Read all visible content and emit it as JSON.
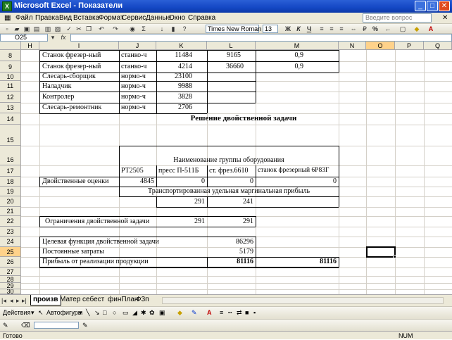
{
  "window": {
    "title": "Microsoft Excel - Показатели",
    "icon_text": "X"
  },
  "menu": {
    "items": [
      "Файл",
      "Правка",
      "Вид",
      "Вставка",
      "Формат",
      "Сервис",
      "Данные",
      "Окно",
      "Справка"
    ],
    "help_placeholder": "Введите вопрос"
  },
  "toolbar": {
    "font_name": "Times New Roman",
    "font_size": "13",
    "bold": "Ж",
    "italic": "К",
    "underline": "Ч",
    "percent": "%"
  },
  "formula_bar": {
    "name_box": "O25"
  },
  "columns": [
    "H",
    "I",
    "J",
    "K",
    "L",
    "M",
    "N",
    "O",
    "P",
    "Q"
  ],
  "selected_column": "O",
  "selected_row": "25",
  "rows": [
    "8",
    "9",
    "10",
    "11",
    "12",
    "13",
    "14",
    "15",
    "16",
    "17",
    "18",
    "19",
    "20",
    "21",
    "22",
    "23",
    "24",
    "25",
    "26",
    "27",
    "28",
    "29",
    "30"
  ],
  "cells": {
    "r8": {
      "i": "Станок фрезер-ный",
      "j": "станко-ч",
      "k": "11484",
      "l": "9165",
      "m": "0,9"
    },
    "r9": {
      "i": "Станок фрезер-ный",
      "j": "станко-ч",
      "k": "4214",
      "l": "36660",
      "m": "0,9"
    },
    "r10": {
      "i": "Слесарь-сборщик",
      "j": "нормо-ч",
      "k": "23100"
    },
    "r11": {
      "i": "Наладчик",
      "j": "нормо-ч",
      "k": "9988"
    },
    "r12": {
      "i": "Контролер",
      "j": "нормо-ч",
      "k": "3828"
    },
    "r13": {
      "i": "Слесарь-ремонтник",
      "j": "нормо-ч",
      "k": "2706"
    },
    "r14": {
      "title": "Решение двойственной задачи"
    },
    "r16": {
      "group_header": "Наименование группы оборудования"
    },
    "r17": {
      "j": "РТ2505",
      "k": "пресс П-511Б",
      "l": "ст. фрез.6610",
      "m": "станок фрезерный 6Р83Г"
    },
    "r18": {
      "i": "Двойственные оценки",
      "j": "4845",
      "k": "0",
      "l": "0",
      "m": "0"
    },
    "r19": {
      "header": "Транспортированная удельная маргинальная прибыль"
    },
    "r20": {
      "k": "291",
      "l": "241"
    },
    "r22": {
      "i": "Ограничения двойственной задачи",
      "k": "291",
      "l": "291"
    },
    "r24": {
      "i": "Целевая функция двойственной задачи",
      "l": "86296"
    },
    "r25": {
      "i": "Постоянные затраты",
      "l": "5179"
    },
    "r26": {
      "i": "Прибыль от реализации продукции",
      "l": "81116",
      "m": "81116"
    }
  },
  "sheet_tabs": [
    "произв",
    "Матер",
    "себест",
    "финПлан",
    "Ф3п"
  ],
  "active_tab": "произв",
  "draw_toolbar": {
    "actions": "Действия",
    "autoshapes": "Автофигуры"
  },
  "status": {
    "ready": "Готово",
    "num": "NUM"
  },
  "colors": {
    "title_bar": "#1447c4",
    "close_button": "#e04a1e",
    "chrome": "#ece9d8",
    "selected_header": "#ffd28a"
  }
}
